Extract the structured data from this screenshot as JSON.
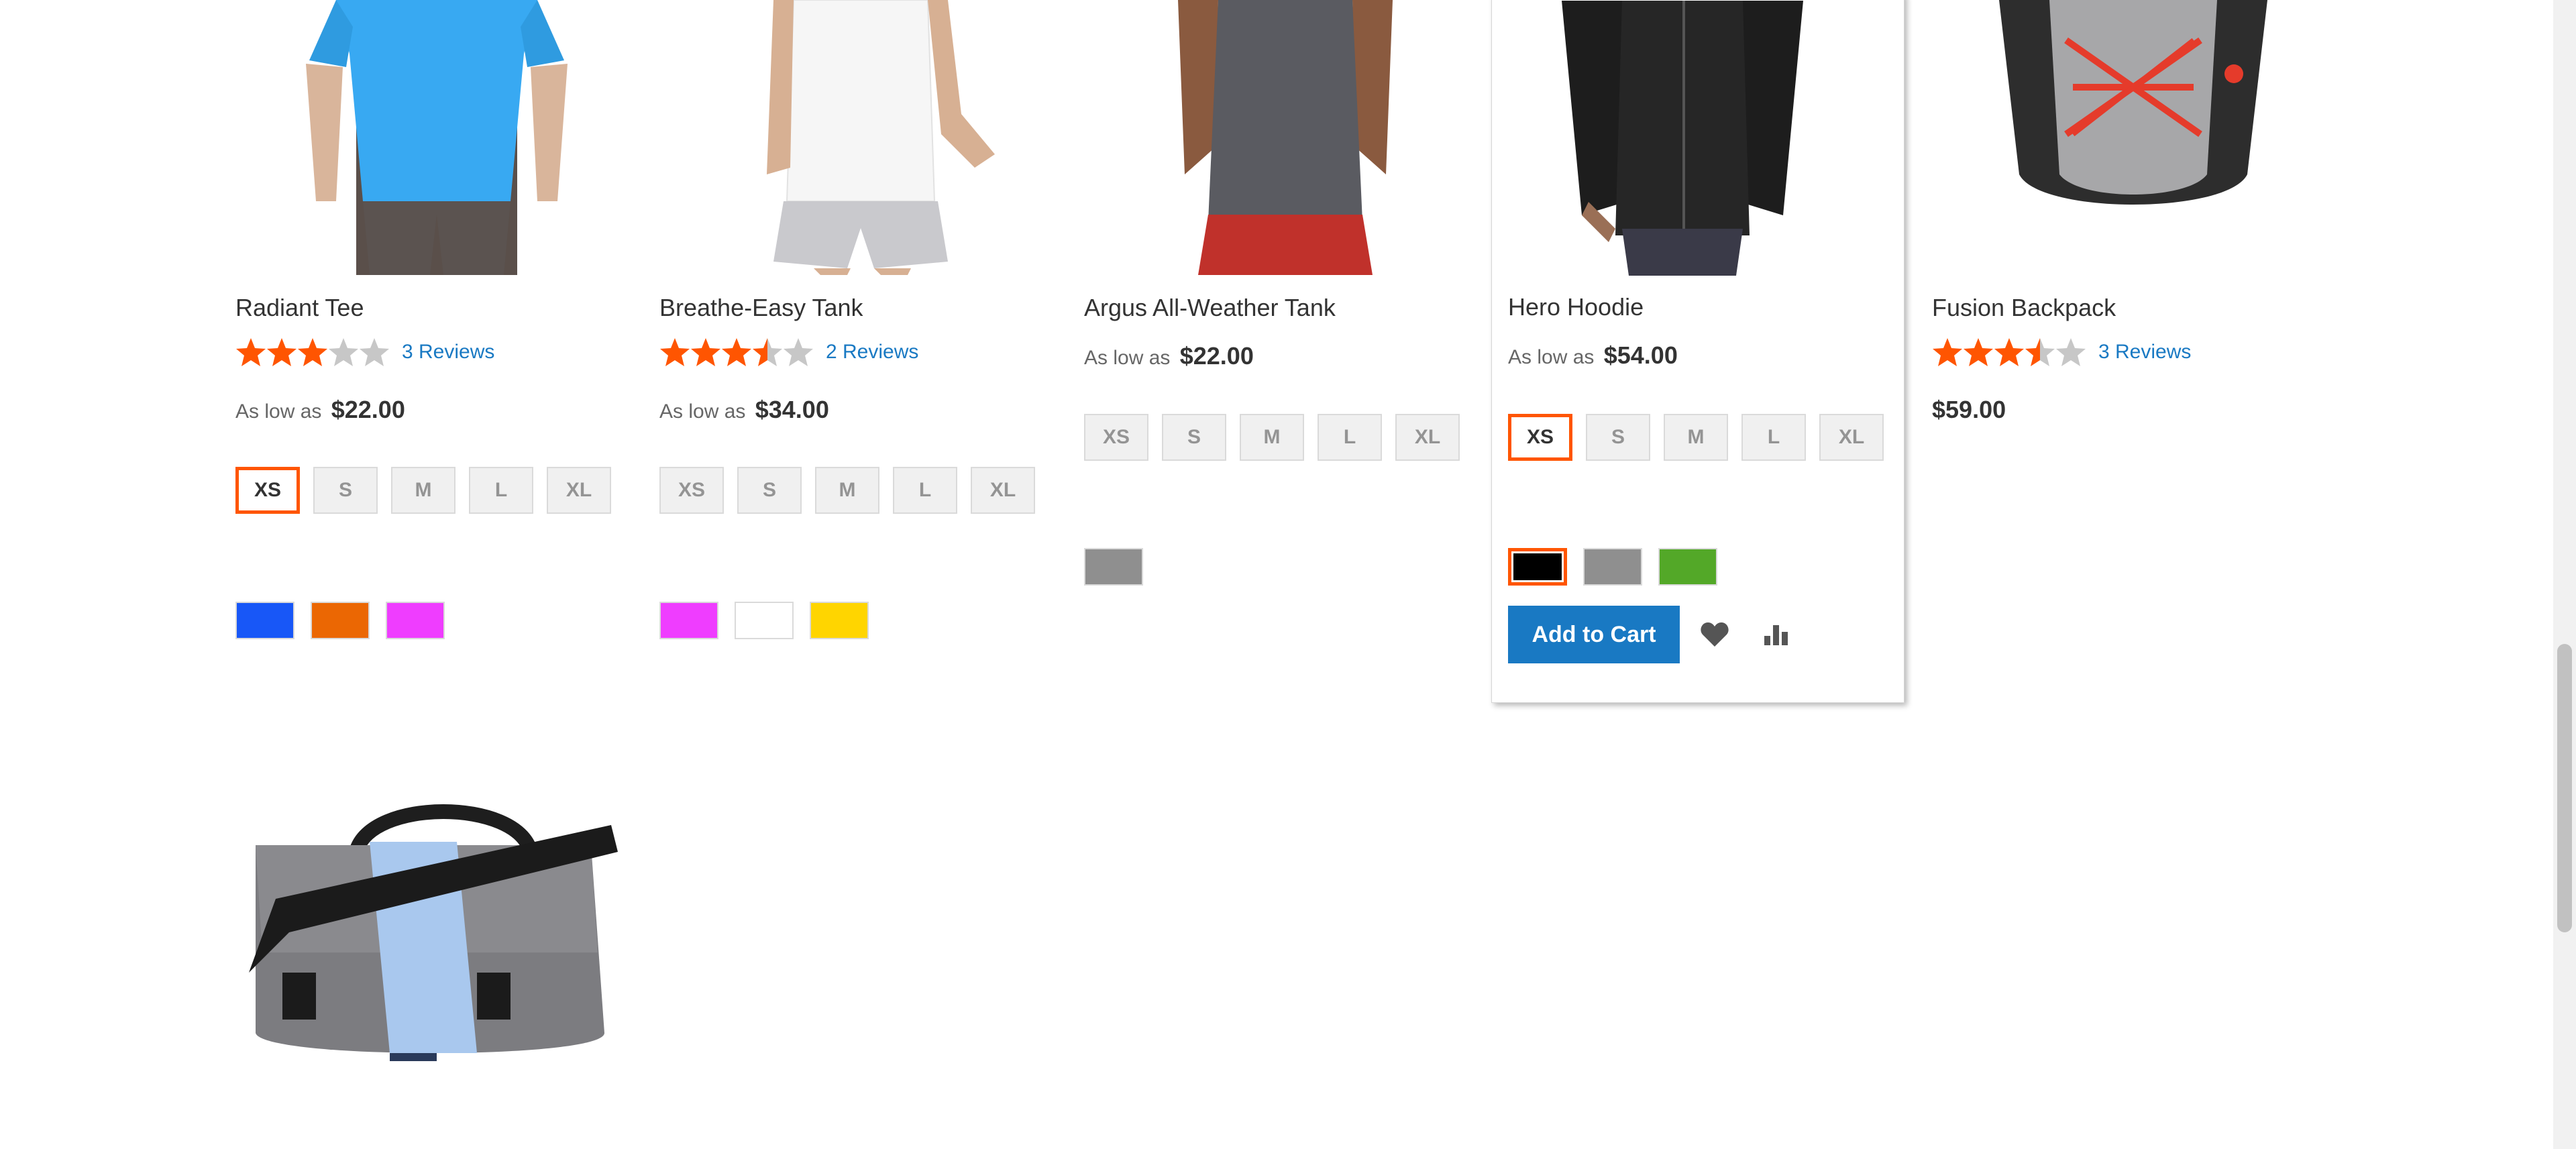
{
  "products": [
    {
      "name": "Radiant Tee",
      "rating_fraction": 0.6,
      "reviews": "3 Reviews",
      "price_prefix": "As low as",
      "price": "$22.00",
      "sizes": [
        "XS",
        "S",
        "M",
        "L",
        "XL"
      ],
      "selected_size": "XS",
      "swatch_colors": [
        "#1857f7",
        "#eb6703",
        "#ef3dff"
      ]
    },
    {
      "name": "Breathe-Easy Tank",
      "rating_fraction": 0.7,
      "reviews": "2 Reviews",
      "price_prefix": "As low as",
      "price": "$34.00",
      "sizes": [
        "XS",
        "S",
        "M",
        "L",
        "XL"
      ],
      "selected_size": "",
      "swatch_colors": [
        "#ef3dff",
        "#ffffff",
        "#ffd500"
      ]
    },
    {
      "name": "Argus All-Weather Tank",
      "price_prefix": "As low as",
      "price": "$22.00",
      "sizes": [
        "XS",
        "S",
        "M",
        "L",
        "XL"
      ],
      "selected_size": "",
      "swatch_colors": [
        "#8f8f8f"
      ]
    },
    {
      "name": "Hero Hoodie",
      "price_prefix": "As low as",
      "price": "$54.00",
      "sizes": [
        "XS",
        "S",
        "M",
        "L",
        "XL"
      ],
      "selected_size": "XS",
      "swatch_colors": [
        "#000000",
        "#8f8f8f",
        "#53a828"
      ],
      "selected_swatch": 0,
      "add_to_cart": "Add to Cart",
      "icons": [
        "heart-icon",
        "bar-chart-icon"
      ]
    },
    {
      "name": "Fusion Backpack",
      "rating_fraction": 0.7,
      "reviews": "3 Reviews",
      "price": "$59.00"
    }
  ],
  "colors": {
    "accent": "#1979c3",
    "star": "#ff5501",
    "selected_border": "#ff5501"
  }
}
